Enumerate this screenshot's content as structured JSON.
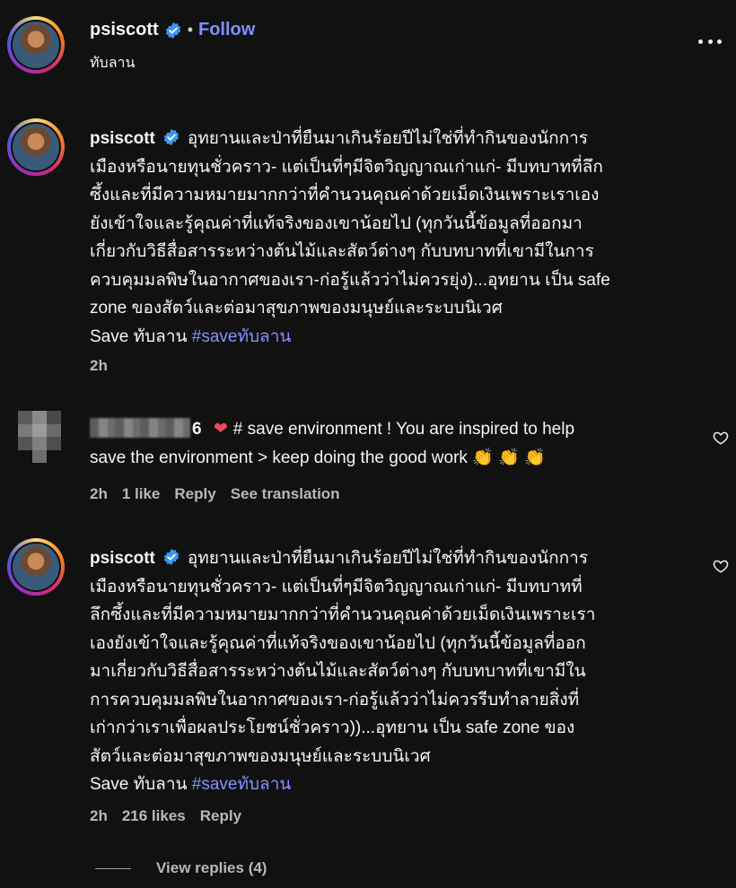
{
  "header": {
    "username": "psiscott",
    "separator": "•",
    "follow_label": "Follow",
    "location": "ทับลาน",
    "more_icon": "more-horizontal-icon"
  },
  "comments": [
    {
      "username": "psiscott",
      "verified": true,
      "text_lines": [
        "อุทยานและป่าที่ยืนมาเกินร้อยปีไม่ใช่ที่ทำกินของนักการ",
        "เมืองหรือนายทุนชั่วคราว- แต่เป็นที่ๆมีจิตวิญญาณเก่าแก่- มีบทบาทที่ลึก",
        "ซึ้งและที่มีความหมายมากกว่าที่คำนวนคุณค่าด้วยเม็ดเงินเพราะเราเอง",
        "ยังเข้าใจและรู้คุณค่าที่แท้จริงของเขาน้อยไป (ทุกวันนี้ข้อมูลที่ออกมา",
        "เกี่ยวกับวิธีสื่อสารระหว่างต้นไม้และสัตว์ต่างๆ กับบทบาทที่เขามีในการ",
        "ควบคุมมลพิษในอากาศของเรา-ก่อรู้แล้วว่าไม่ควรยุ่ง)...อุทยาน เป็น safe",
        "zone ของสัตว์และต่อมาสุขภาพของมนุษย์และระบบนิเวศ"
      ],
      "save_text": "Save ทับลาน",
      "hashtag": "#saveทับลาน",
      "time": "2h"
    },
    {
      "username_suffix": "6",
      "emoji": "❤",
      "text_lines": [
        "# save environment ! You are inspired to help",
        "save the environment > keep doing the good work 👏 👏 👏"
      ],
      "time": "2h",
      "likes": "1 like",
      "reply_label": "Reply",
      "translate_label": "See translation"
    },
    {
      "username": "psiscott",
      "verified": true,
      "text_lines": [
        "อุทยานและป่าที่ยืนมาเกินร้อยปีไม่ใช่ที่ทำกินของนักการ",
        "เมืองหรือนายทุนชั่วคราว- แต่เป็นที่ๆมีจิตวิญญาณเก่าแก่- มีบทบาทที่",
        "ลึกซึ้งและที่มีความหมายมากกว่าที่คำนวนคุณค่าด้วยเม็ดเงินเพราะเรา",
        "เองยังเข้าใจและรู้คุณค่าที่แท้จริงของเขาน้อยไป (ทุกวันนี้ข้อมูลที่ออก",
        "มาเกี่ยวกับวิธีสื่อสารระหว่างต้นไม้และสัตว์ต่างๆ กับบทบาทที่เขามีใน",
        "การควบคุมมลพิษในอากาศของเรา-ก่อรู้แล้วว่าไม่ควรรีบทำลายสิ่งที่",
        "เก่ากว่าเราเพื่อผลประโยชน์ชั่วคราว))...อุทยาน เป็น safe zone ของ",
        "สัตว์และต่อมาสุขภาพของมนุษย์และระบบนิเวศ"
      ],
      "save_text": "Save ทับลาน",
      "hashtag": "#saveทับลาน",
      "time": "2h",
      "likes": "216 likes",
      "reply_label": "Reply"
    }
  ],
  "view_replies": "View replies (4)",
  "colors": {
    "background": "#111111",
    "link": "#8591ff",
    "follow": "#7f8fff",
    "verified": "#3897f0",
    "heart_red": "#ed4956"
  }
}
